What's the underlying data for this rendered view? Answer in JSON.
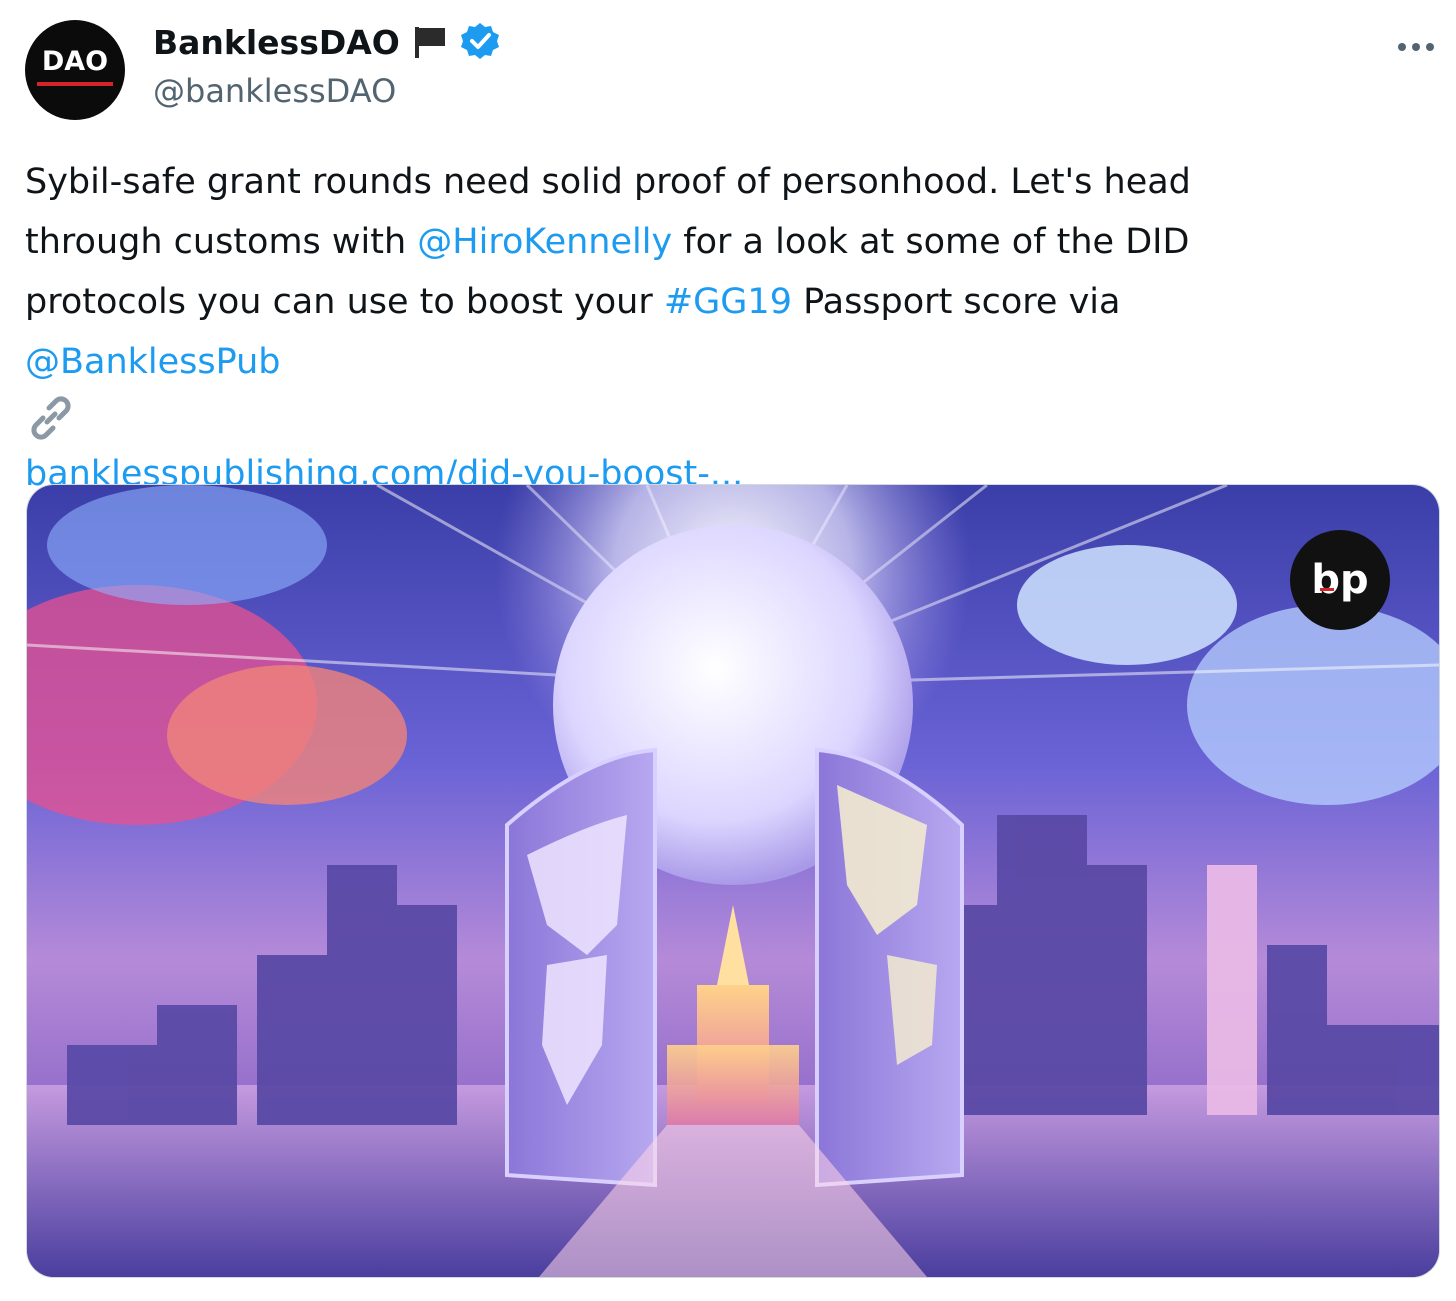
{
  "author": {
    "display_name": "BanklessDAO",
    "handle": "@banklessDAO",
    "avatar_text": "DAO",
    "flag_icon": "black-flag-icon",
    "verified_icon": "verified-badge-icon"
  },
  "header": {
    "more_icon": "more-horizontal-icon",
    "more_label": "···"
  },
  "tweet": {
    "line1": "Sybil-safe grant rounds need solid proof of personhood. Let's head",
    "line2_pre": "through customs with ",
    "mention1": "@HiroKennelly",
    "line2_post": " for a look at some of the DID",
    "line3_pre": "protocols you can use to boost your ",
    "hashtag": "#GG19",
    "line3_post": " Passport score via",
    "mention2": "@BanklessPub",
    "link_icon": "link-icon",
    "link_text": "banklesspublishing.com/did-you-boost-..."
  },
  "media": {
    "badge_text": "bp",
    "description_icon": "illustration-world-gates-city"
  },
  "colors": {
    "link": "#1d9bf0",
    "text": "#0f1419",
    "muted": "#536471",
    "verified": "#1d9bf0"
  }
}
